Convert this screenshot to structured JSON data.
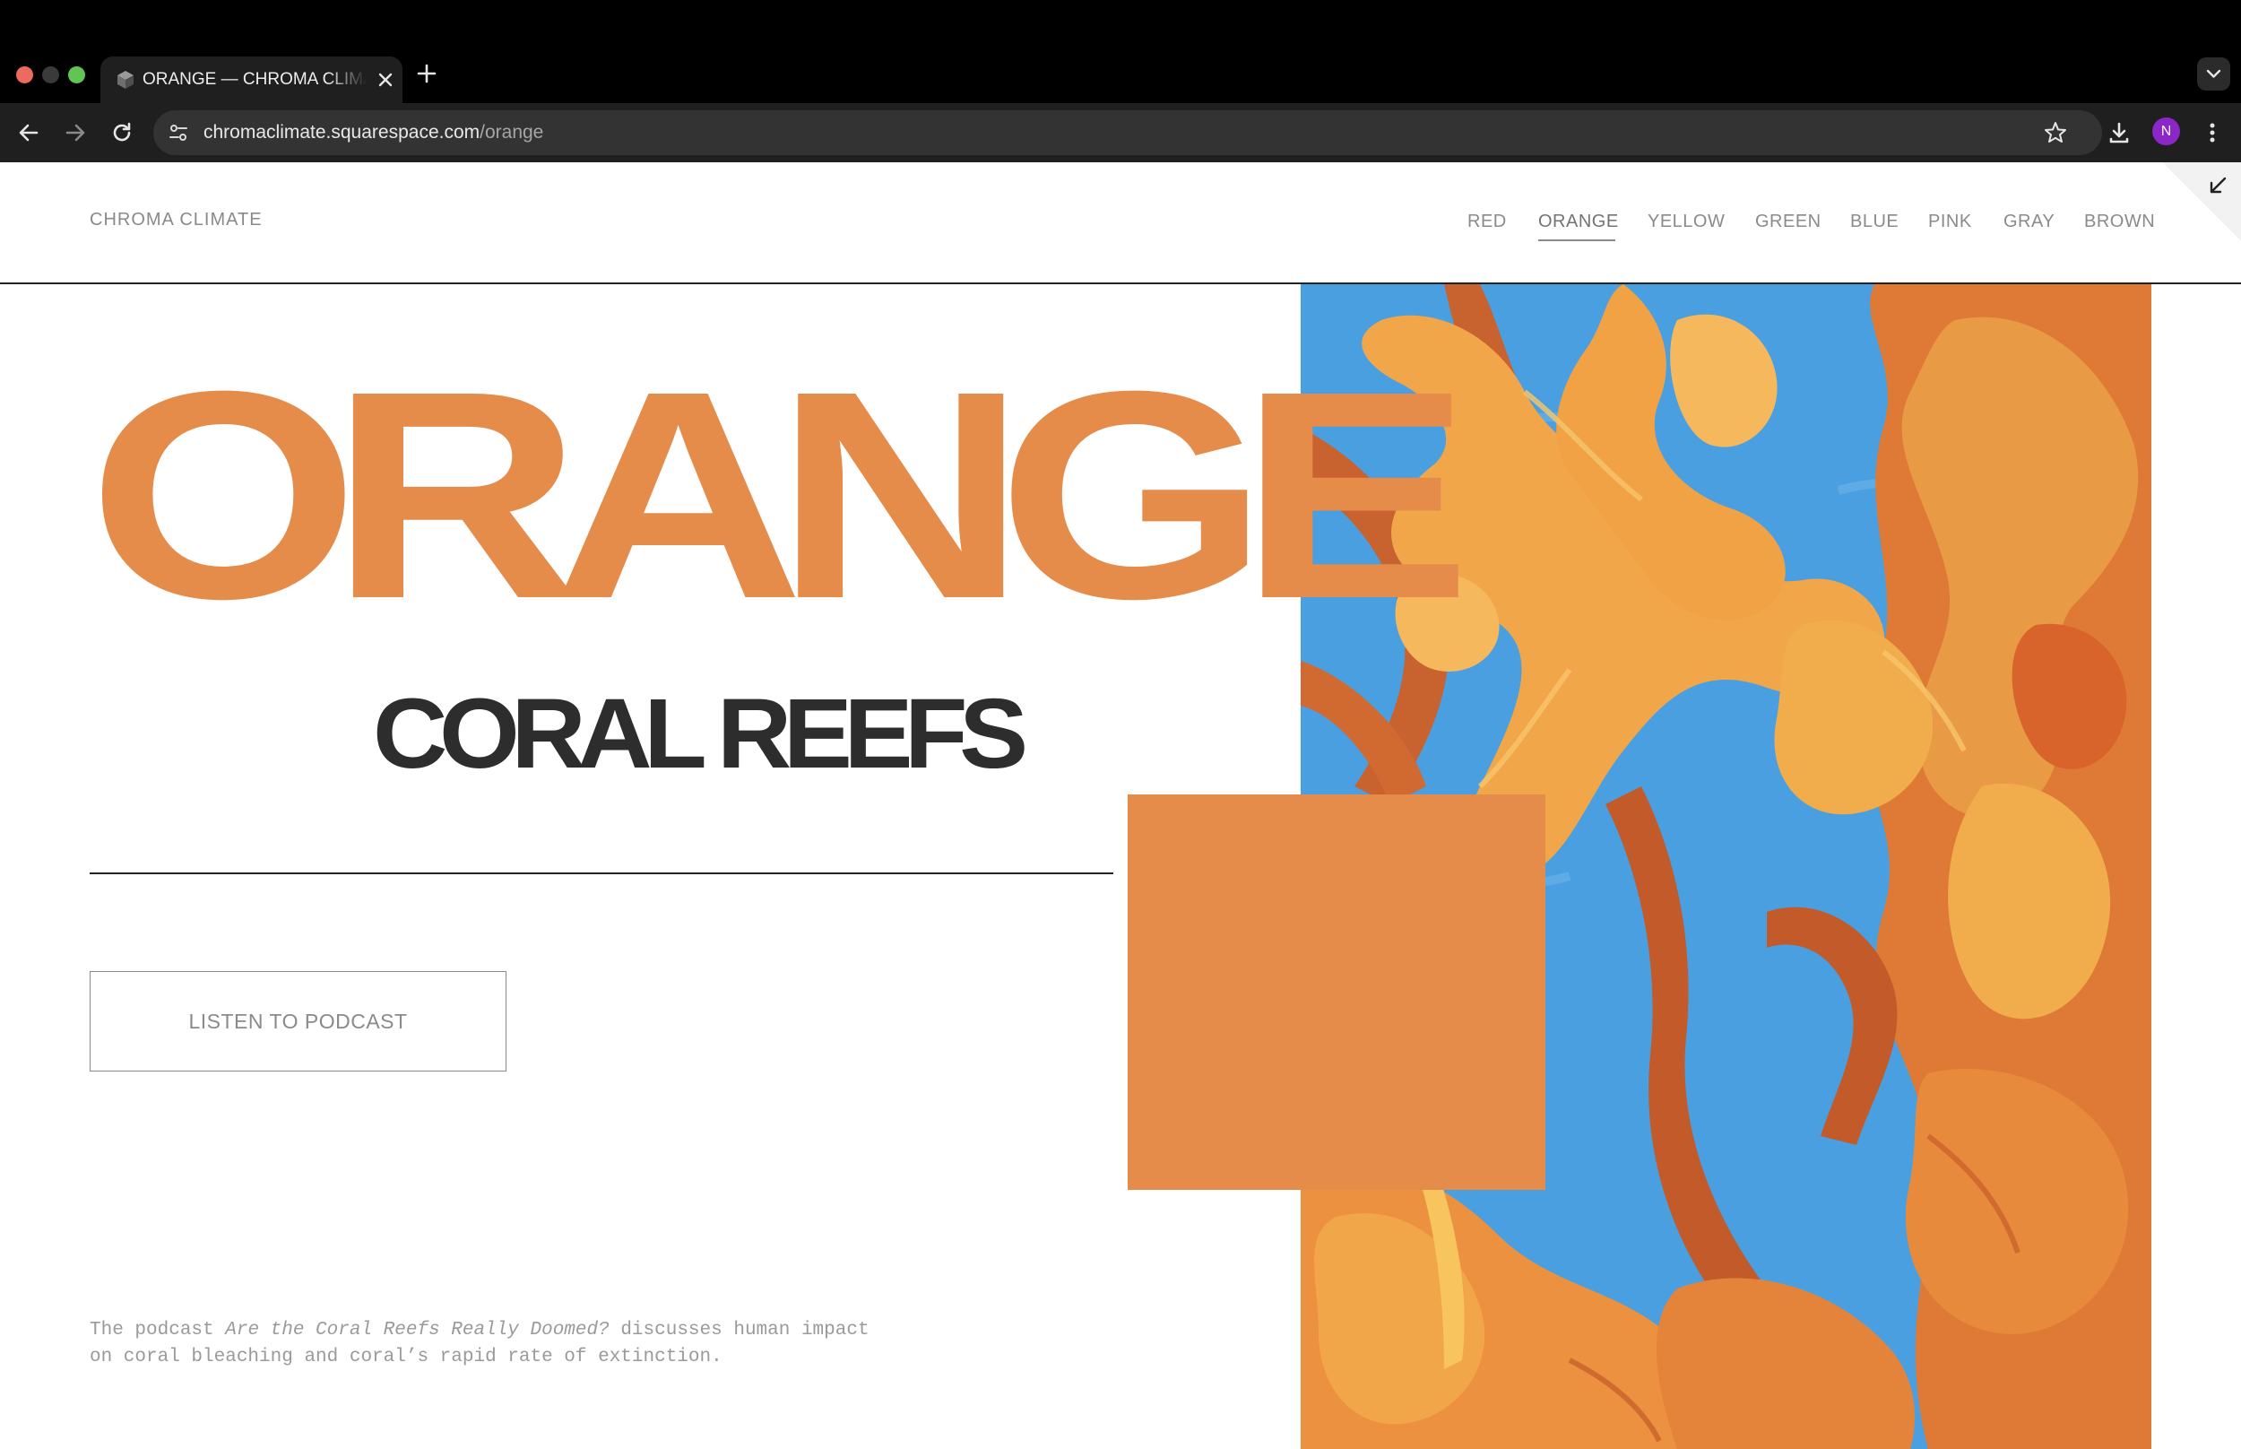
{
  "browser": {
    "tab_title": "ORANGE — CHROMA CLIMATE",
    "url_host": "chromaclimate.squarespace.com",
    "url_path": "/orange",
    "profile_initial": "N"
  },
  "site": {
    "title": "CHROMA CLIMATE",
    "nav": [
      "RED",
      "ORANGE",
      "YELLOW",
      "GREEN",
      "BLUE",
      "PINK",
      "GRAY",
      "BROWN"
    ],
    "active_nav": "ORANGE"
  },
  "hero": {
    "word": "ORANGE",
    "subhead": "CORAL REEFS",
    "button": "LISTEN TO PODCAST",
    "description_pre": "The podcast ",
    "description_em": "Are the Coral Reefs Really Doomed?",
    "description_post": " discusses human impact on coral bleaching and coral’s rapid rate of extinction."
  },
  "colors": {
    "accent": "#e58c4a",
    "heading": "#2d2d2d",
    "nav_text": "#8a8a8a",
    "painting_sky": "#4a9fe0"
  },
  "icons": {
    "tab_favicon": "cube-icon",
    "tab_close": "close-icon",
    "new_tab": "plus-icon",
    "tab_search": "chevron-down-icon",
    "back": "back-arrow-icon",
    "forward": "forward-arrow-icon",
    "reload": "reload-icon",
    "site_info": "tune-icon",
    "bookmark": "star-icon",
    "download": "download-icon",
    "menu": "kebab-menu-icon",
    "expand": "collapse-arrow-icon"
  }
}
